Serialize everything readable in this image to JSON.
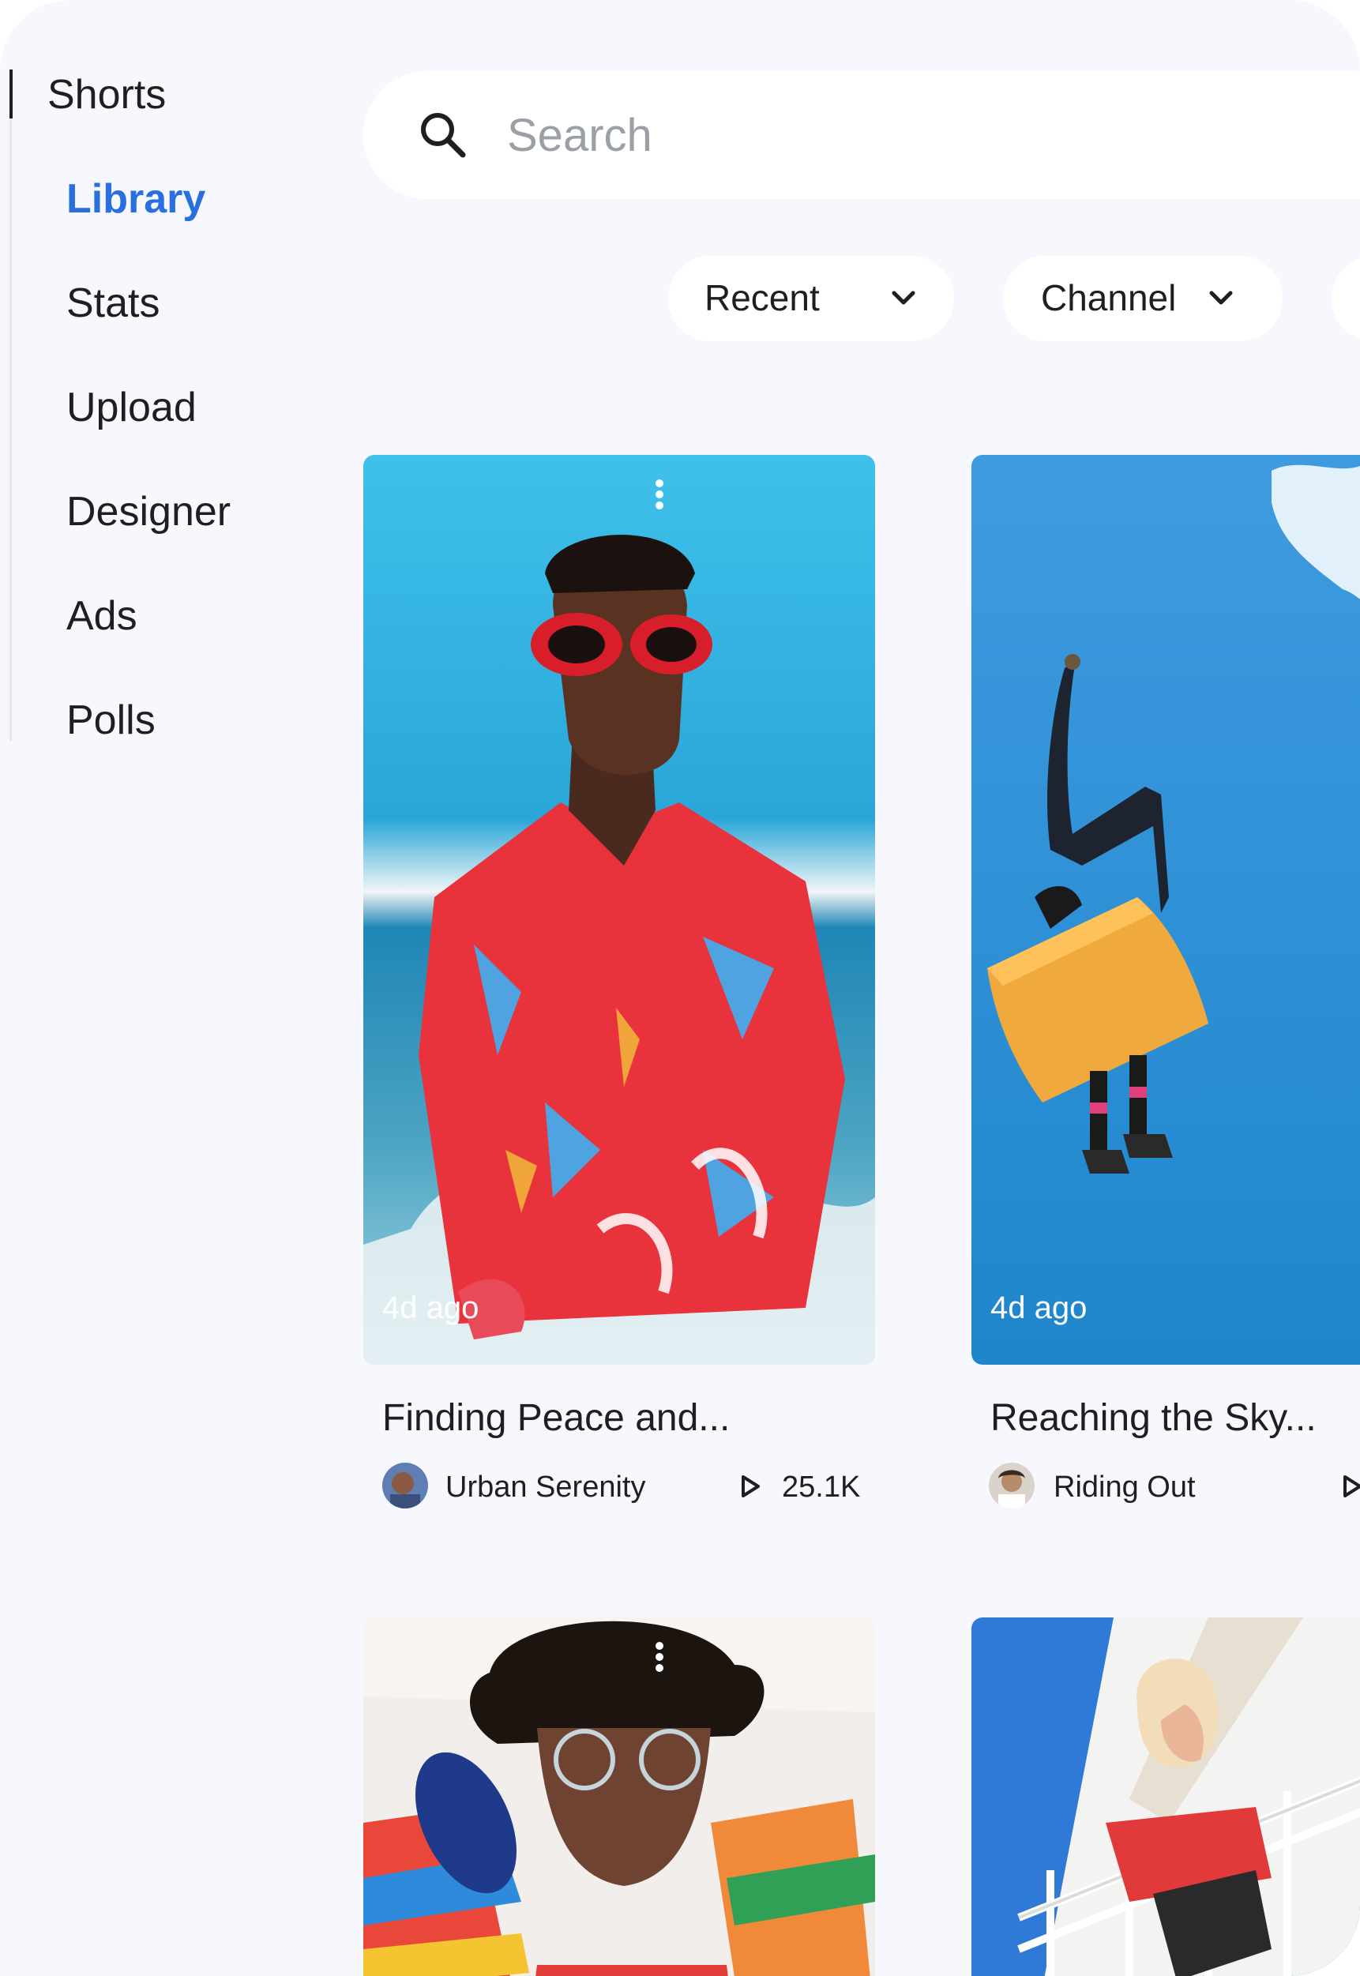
{
  "sidebar": {
    "items": [
      {
        "label": "Shorts"
      },
      {
        "label": "Library",
        "active": true
      },
      {
        "label": "Stats"
      },
      {
        "label": "Upload"
      },
      {
        "label": "Designer"
      },
      {
        "label": "Ads"
      },
      {
        "label": "Polls"
      }
    ],
    "active_color": "#2a6fe0"
  },
  "search": {
    "placeholder": "Search",
    "icon": "search-icon"
  },
  "filters": [
    {
      "label": "Recent",
      "icon": "chevron-down-icon"
    },
    {
      "label": "Channel",
      "icon": "chevron-down-icon"
    }
  ],
  "videos": [
    {
      "age": "4d ago",
      "title": "Finding Peace and...",
      "channel": "Urban Serenity",
      "views": "25.1K"
    },
    {
      "age": "4d ago",
      "title": "Reaching the Sky...",
      "channel": "Riding Out",
      "views": ""
    },
    {
      "age": "",
      "title": "",
      "channel": "",
      "views": ""
    },
    {
      "age": "",
      "title": "",
      "channel": "",
      "views": ""
    }
  ]
}
